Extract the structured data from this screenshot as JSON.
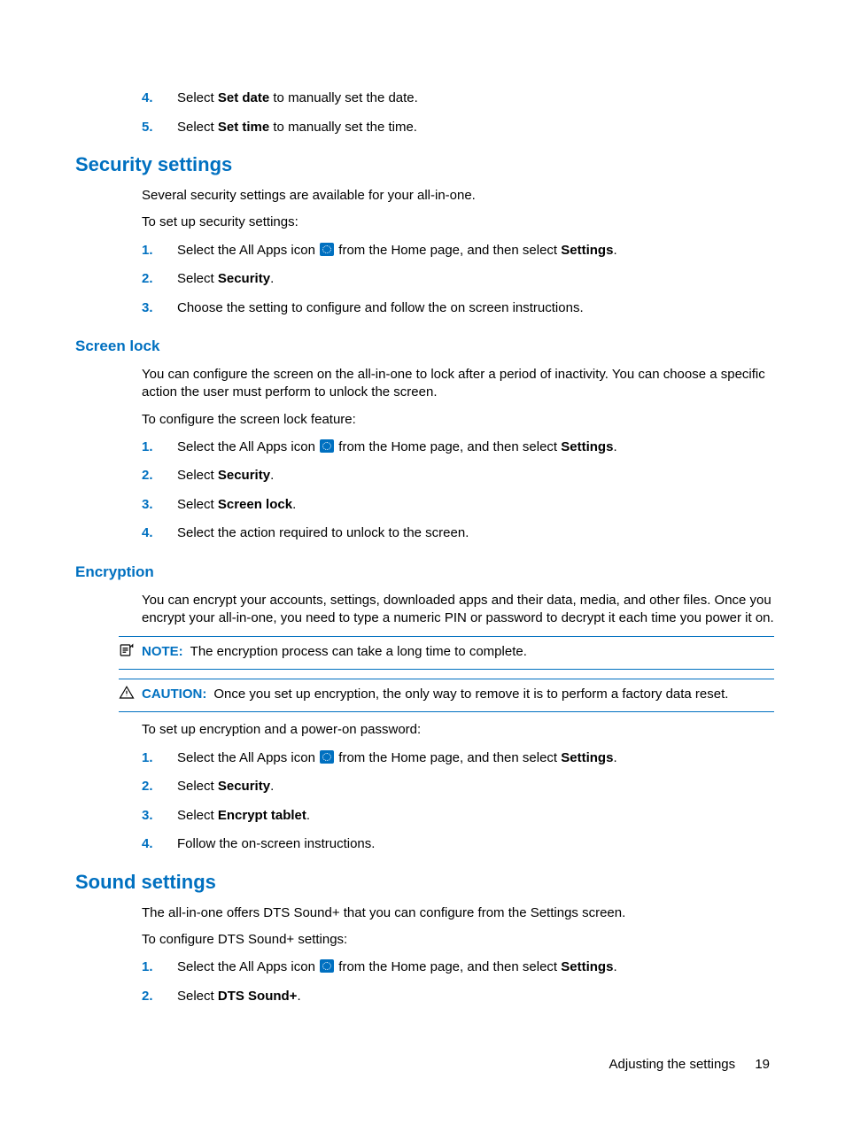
{
  "dateTimeSteps": [
    {
      "n": "4.",
      "pre": "Select ",
      "b": "Set date",
      "post": " to manually set the date."
    },
    {
      "n": "5.",
      "pre": "Select ",
      "b": "Set time",
      "post": " to manually set the time."
    }
  ],
  "security": {
    "heading": "Security settings",
    "intro1": "Several security settings are available for your all-in-one.",
    "intro2": "To set up security settings:",
    "steps": [
      {
        "n": "1.",
        "pre": "Select the All Apps icon ",
        "icon": true,
        "mid": " from the Home page, and then select ",
        "b": "Settings",
        "post": "."
      },
      {
        "n": "2.",
        "pre": "Select ",
        "b": "Security",
        "post": "."
      },
      {
        "n": "3.",
        "pre": "Choose the setting to configure and follow the on screen instructions.",
        "b": "",
        "post": ""
      }
    ]
  },
  "screenLock": {
    "heading": "Screen lock",
    "p1": "You can configure the screen on the all-in-one to lock after a period of inactivity. You can choose a specific action the user must perform to unlock the screen.",
    "p2": "To configure the screen lock feature:",
    "steps": [
      {
        "n": "1.",
        "pre": "Select the All Apps icon ",
        "icon": true,
        "mid": " from the Home page, and then select ",
        "b": "Settings",
        "post": "."
      },
      {
        "n": "2.",
        "pre": "Select ",
        "b": "Security",
        "post": "."
      },
      {
        "n": "3.",
        "pre": "Select ",
        "b": "Screen lock",
        "post": "."
      },
      {
        "n": "4.",
        "pre": "Select the action required to unlock to the screen.",
        "b": "",
        "post": ""
      }
    ]
  },
  "encryption": {
    "heading": "Encryption",
    "p1": "You can encrypt your accounts, settings, downloaded apps and their data, media, and other files. Once you encrypt your all-in-one, you need to type a numeric PIN or password to decrypt it each time you power it on.",
    "noteLabel": "NOTE:",
    "noteText": "The encryption process can take a long time to complete.",
    "cautionLabel": "CAUTION:",
    "cautionText": "Once you set up encryption, the only way to remove it is to perform a factory data reset.",
    "p2": "To set up encryption and a power-on password:",
    "steps": [
      {
        "n": "1.",
        "pre": "Select the All Apps icon ",
        "icon": true,
        "mid": " from the Home page, and then select ",
        "b": "Settings",
        "post": "."
      },
      {
        "n": "2.",
        "pre": "Select ",
        "b": "Security",
        "post": "."
      },
      {
        "n": "3.",
        "pre": "Select ",
        "b": "Encrypt tablet",
        "post": "."
      },
      {
        "n": "4.",
        "pre": "Follow the on-screen instructions.",
        "b": "",
        "post": ""
      }
    ]
  },
  "sound": {
    "heading": "Sound settings",
    "p1": "The all-in-one offers DTS Sound+ that you can configure from the Settings screen.",
    "p2": "To configure DTS Sound+ settings:",
    "steps": [
      {
        "n": "1.",
        "pre": "Select the All Apps icon ",
        "icon": true,
        "mid": " from the Home page, and then select ",
        "b": "Settings",
        "post": "."
      },
      {
        "n": "2.",
        "pre": "Select ",
        "b": "DTS Sound+",
        "post": "."
      }
    ]
  },
  "footer": {
    "text": "Adjusting the settings",
    "page": "19"
  }
}
